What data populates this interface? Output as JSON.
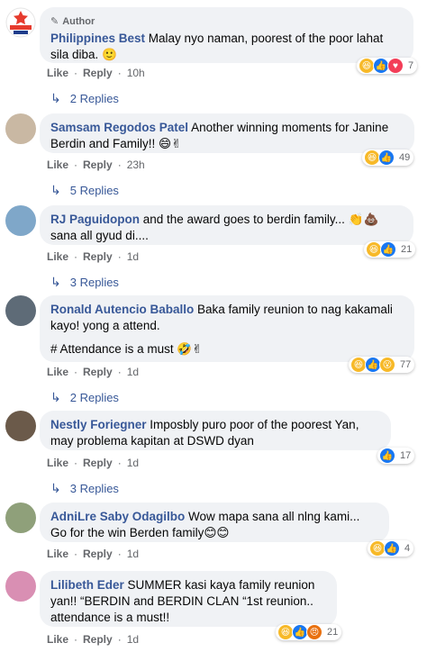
{
  "comments": [
    {
      "author_badge": "Author",
      "name": "Philippines Best",
      "text": "Malay nyo naman, poorest of the poor lahat sila diba. 🙂",
      "like": "Like",
      "reply": "Reply",
      "time": "10h",
      "reactions_count": "7",
      "reactions": [
        "haha-icon",
        "like-icon",
        "love-icon"
      ],
      "replies_label": "2 Replies"
    },
    {
      "name": "Samsam Regodos Patel",
      "text": "Another winning moments for Janine Berdin and Family!! 😄✌",
      "like": "Like",
      "reply": "Reply",
      "time": "23h",
      "reactions_count": "49",
      "reactions": [
        "haha-icon",
        "like-icon"
      ],
      "replies_label": "5 Replies"
    },
    {
      "name": "RJ Paguidopon",
      "text": "and the award goes to berdin family... 👏💩 sana all gyud di....",
      "like": "Like",
      "reply": "Reply",
      "time": "1d",
      "reactions_count": "21",
      "reactions": [
        "haha-icon",
        "like-icon"
      ],
      "replies_label": "3 Replies"
    },
    {
      "name": "Ronald Autencio Baballo",
      "text": "Baka family reunion to nag kakamali kayo! yong a attend.",
      "text2": "# Attendance is a must 🤣✌",
      "like": "Like",
      "reply": "Reply",
      "time": "1d",
      "reactions_count": "77",
      "reactions": [
        "haha-icon",
        "like-icon",
        "wow-icon"
      ],
      "replies_label": "2 Replies"
    },
    {
      "name": "Nestly Foriegner",
      "text": "Imposbly puro poor of the poorest Yan, may problema kapitan at DSWD dyan",
      "like": "Like",
      "reply": "Reply",
      "time": "1d",
      "reactions_count": "17",
      "reactions": [
        "like-icon"
      ],
      "replies_label": "3 Replies"
    },
    {
      "name": "AdniLre Saby Odagilbo",
      "text": "Wow mapa sana all nlng kami... Go for the win Berden family😊😊",
      "like": "Like",
      "reply": "Reply",
      "time": "1d",
      "reactions_count": "4",
      "reactions": [
        "haha-icon",
        "like-icon"
      ]
    },
    {
      "name": "Lilibeth Eder",
      "text": "SUMMER kasi kaya family reunion yan!! “BERDIN and BERDIN CLAN “1st reunion.. attendance is a must!!",
      "like": "Like",
      "reply": "Reply",
      "time": "1d",
      "reactions_count": "21",
      "reactions": [
        "haha-icon",
        "like-icon",
        "angry-icon"
      ]
    }
  ],
  "icons": {
    "author": "pencil-icon",
    "replies": "reply-arrow-icon"
  },
  "colors": {
    "name": "#385898",
    "bubble": "#f0f2f5",
    "meta": "#65676b",
    "like": "#1877f2",
    "love": "#f33e58",
    "haha": "#f7b928"
  }
}
